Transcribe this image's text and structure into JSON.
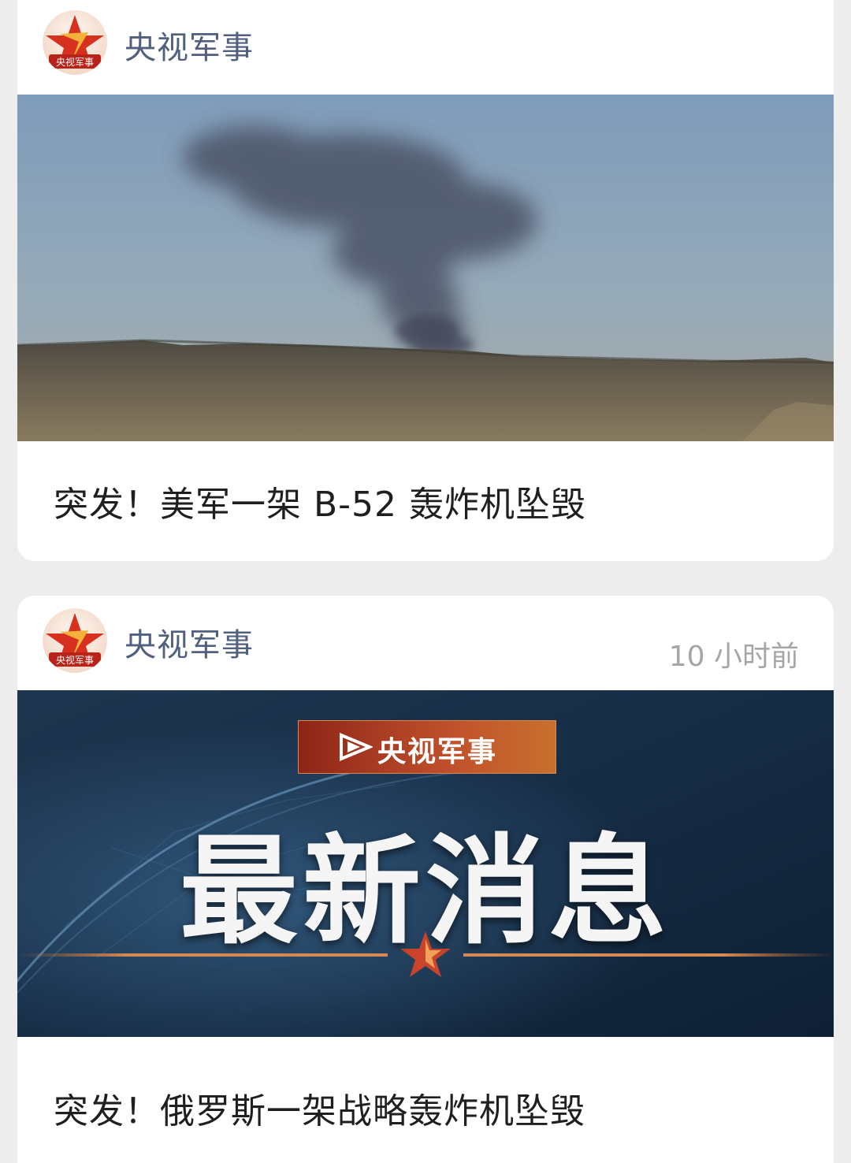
{
  "feed": {
    "posts": [
      {
        "account": "央视军事",
        "avatar_badge": "央视军事",
        "time": "",
        "image": "smoke-plume-over-desert",
        "headline": "突发！美军一架 B-52 轰炸机坠毁"
      },
      {
        "account": "央视军事",
        "avatar_badge": "央视军事",
        "time": "10 小时前",
        "image": "breaking-news-banner",
        "banner_label": "央视军事",
        "banner_title": "最新消息",
        "headline": "突发！俄罗斯一架战略轰炸机坠毁"
      }
    ]
  },
  "colors": {
    "account": "#51607f",
    "timestamp": "#a6a6a6",
    "headline": "#1f1f1f",
    "background": "#ededed",
    "brand_red": "#c1512c"
  }
}
